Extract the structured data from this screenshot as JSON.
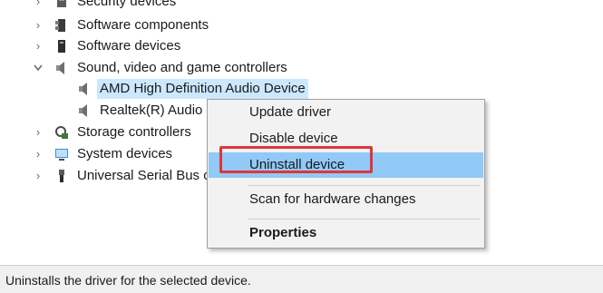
{
  "tree": {
    "items": [
      {
        "label": "Security devices",
        "icon": "security-device-icon",
        "expander": "chevron-right-icon"
      },
      {
        "label": "Software components",
        "icon": "software-component-icon",
        "expander": "chevron-right-icon"
      },
      {
        "label": "Software devices",
        "icon": "software-device-icon",
        "expander": "chevron-right-icon"
      },
      {
        "label": "Sound, video and game controllers",
        "icon": "speaker-icon",
        "expander": "chevron-down-icon"
      },
      {
        "label": "AMD High Definition Audio Device",
        "icon": "speaker-icon"
      },
      {
        "label": "Realtek(R) Audio",
        "icon": "speaker-icon"
      },
      {
        "label": "Storage controllers",
        "icon": "storage-controller-icon",
        "expander": "chevron-right-icon"
      },
      {
        "label": "System devices",
        "icon": "system-device-icon",
        "expander": "chevron-right-icon"
      },
      {
        "label": "Universal Serial Bus c",
        "icon": "usb-icon",
        "expander": "chevron-right-icon"
      }
    ]
  },
  "context_menu": {
    "items": [
      {
        "label": "Update driver"
      },
      {
        "label": "Disable device"
      },
      {
        "label": "Uninstall device",
        "highlighted": true
      },
      {
        "label": "Scan for hardware changes"
      },
      {
        "label": "Properties",
        "bold": true
      }
    ]
  },
  "status_bar": {
    "text": "Uninstalls the driver for the selected device."
  },
  "colors": {
    "selection": "#cce8ff",
    "menu_highlight": "#91c9f7",
    "callout_border": "#e0353a"
  }
}
